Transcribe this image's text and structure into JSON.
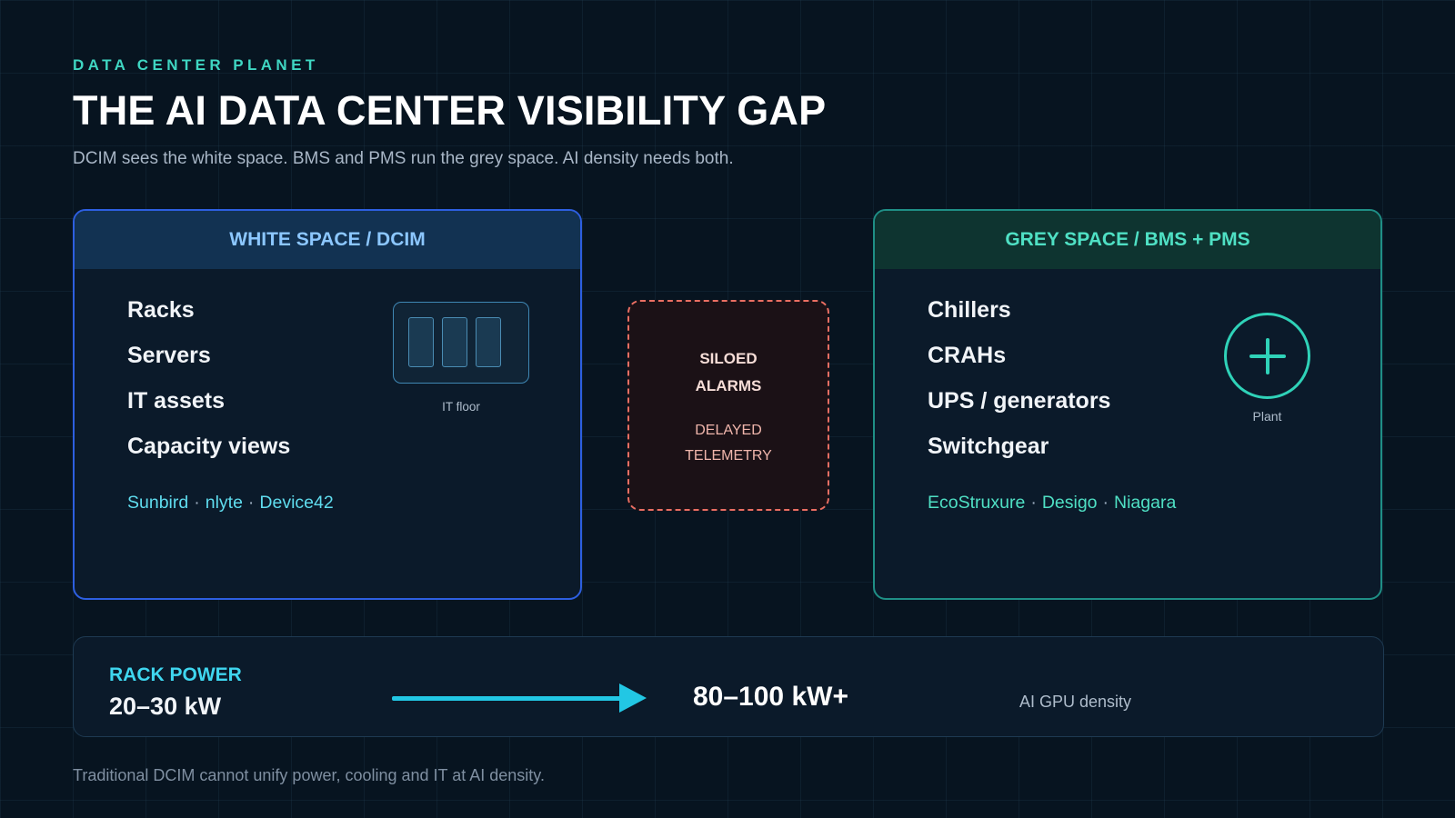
{
  "header": {
    "brand": "DATA CENTER PLANET",
    "title": "THE AI DATA CENTER VISIBILITY GAP",
    "subtitle": "DCIM sees the white space. BMS and PMS run the grey space. AI density needs both."
  },
  "white_space": {
    "heading": "WHITE SPACE / DCIM",
    "items": [
      "Racks",
      "Servers",
      "IT assets",
      "Capacity views"
    ],
    "icon": "server-rack-icon",
    "icon_caption": "IT floor",
    "vendors": [
      "Sunbird",
      "nlyte",
      "Device42"
    ],
    "separator": "·",
    "accent": "#2d5fe0"
  },
  "gap": {
    "line1": "SILOED",
    "line2": "ALARMS",
    "line3": "DELAYED",
    "line4": "TELEMETRY",
    "accent": "#ea6e62"
  },
  "grey_space": {
    "heading": "GREY SPACE / BMS + PMS",
    "items": [
      "Chillers",
      "CRAHs",
      "UPS / generators",
      "Switchgear"
    ],
    "icon": "plant-plus-icon",
    "icon_caption": "Plant",
    "vendors": [
      "EcoStruxure",
      "Desigo",
      "Niagara"
    ],
    "separator": "·",
    "accent": "#1f8f86"
  },
  "rack_power": {
    "label": "RACK POWER",
    "from": "20–30 kW",
    "to": "80–100 kW+",
    "note": "AI GPU density",
    "arrow_color": "#22c7e4"
  },
  "footer": {
    "text": "Traditional DCIM cannot unify power, cooling and IT at AI density."
  }
}
